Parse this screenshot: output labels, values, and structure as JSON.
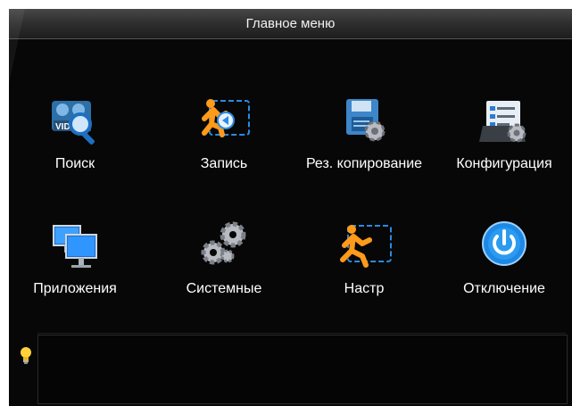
{
  "window": {
    "title": "Главное меню"
  },
  "menu": {
    "items": [
      {
        "label": "Поиск",
        "icon": "video-search-icon"
      },
      {
        "label": "Запись",
        "icon": "record-runner-icon"
      },
      {
        "label": "Рез. копирование",
        "icon": "backup-disk-icon"
      },
      {
        "label": "Конфигурация",
        "icon": "config-checklist-icon"
      },
      {
        "label": "Приложения",
        "icon": "monitors-icon"
      },
      {
        "label": "Системные",
        "icon": "gears-icon"
      },
      {
        "label": "Настр",
        "icon": "setup-runner-icon"
      },
      {
        "label": "Отключение",
        "icon": "power-icon"
      }
    ]
  },
  "hint": {
    "icon": "lightbulb-icon",
    "text": ""
  },
  "colors": {
    "background": "#070707",
    "titlebar": "#2e2e2e",
    "accent": "#1e88e5",
    "runner": "#ff9a1a"
  }
}
